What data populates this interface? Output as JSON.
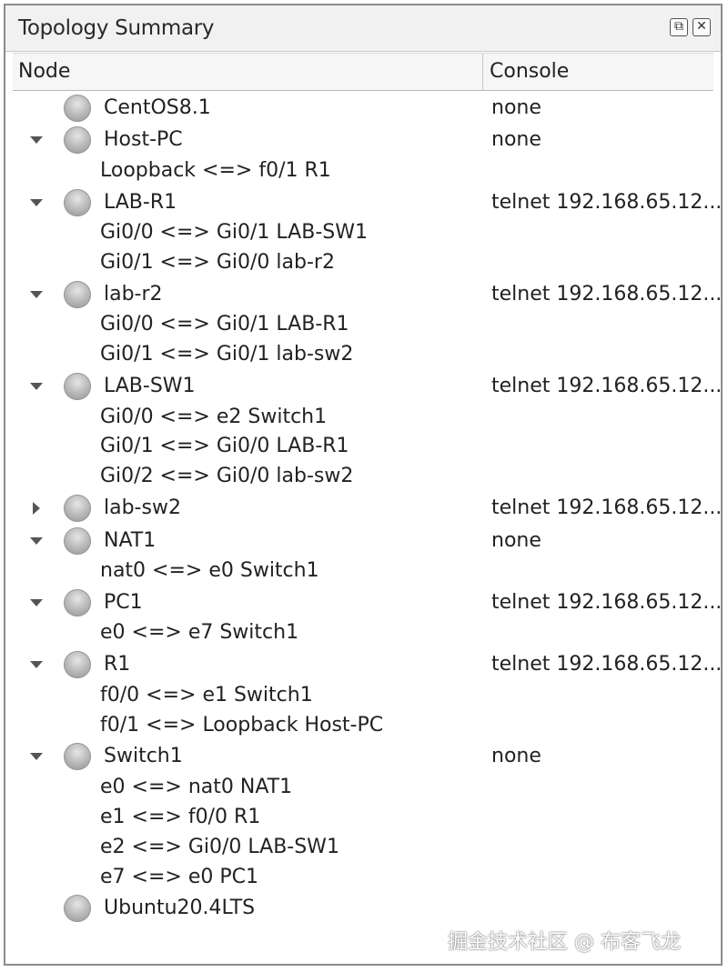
{
  "panel": {
    "title": "Topology Summary",
    "float_icon": "float-window-icon",
    "close_icon": "close-window-icon"
  },
  "columns": {
    "node": "Node",
    "console": "Console"
  },
  "nodes": [
    {
      "name": "CentOS8.1",
      "console": "none",
      "expander": "none",
      "links": []
    },
    {
      "name": "Host-PC",
      "console": "none",
      "expander": "down",
      "links": [
        "Loopback <=> f0/1 R1"
      ]
    },
    {
      "name": "LAB-R1",
      "console": "telnet 192.168.65.12...",
      "expander": "down",
      "links": [
        "Gi0/0 <=> Gi0/1 LAB-SW1",
        "Gi0/1 <=> Gi0/0 lab-r2"
      ]
    },
    {
      "name": "lab-r2",
      "console": "telnet 192.168.65.12...",
      "expander": "down",
      "links": [
        "Gi0/0 <=> Gi0/1 LAB-R1",
        "Gi0/1 <=> Gi0/1 lab-sw2"
      ]
    },
    {
      "name": "LAB-SW1",
      "console": "telnet 192.168.65.12...",
      "expander": "down",
      "links": [
        "Gi0/0 <=> e2 Switch1",
        "Gi0/1 <=> Gi0/0 LAB-R1",
        "Gi0/2 <=> Gi0/0 lab-sw2"
      ]
    },
    {
      "name": "lab-sw2",
      "console": "telnet 192.168.65.12...",
      "expander": "right",
      "links": []
    },
    {
      "name": "NAT1",
      "console": "none",
      "expander": "down",
      "links": [
        "nat0 <=> e0 Switch1"
      ]
    },
    {
      "name": "PC1",
      "console": "telnet 192.168.65.12...",
      "expander": "down",
      "links": [
        "e0 <=> e7 Switch1"
      ]
    },
    {
      "name": "R1",
      "console": "telnet 192.168.65.12...",
      "expander": "down",
      "links": [
        "f0/0 <=> e1 Switch1",
        "f0/1 <=> Loopback Host-PC"
      ]
    },
    {
      "name": "Switch1",
      "console": "none",
      "expander": "down",
      "links": [
        "e0 <=> nat0 NAT1",
        "e1 <=> f0/0 R1",
        "e2 <=> Gi0/0 LAB-SW1",
        "e7 <=> e0 PC1"
      ]
    },
    {
      "name": "Ubuntu20.4LTS",
      "console": "",
      "expander": "none",
      "links": []
    }
  ],
  "watermark": "掘金技术社区 @ 布客飞龙",
  "colors": {
    "status_node": "#a8a8a8",
    "header_bg": "#f6f6f6",
    "title_bg": "#f1f1f1"
  }
}
